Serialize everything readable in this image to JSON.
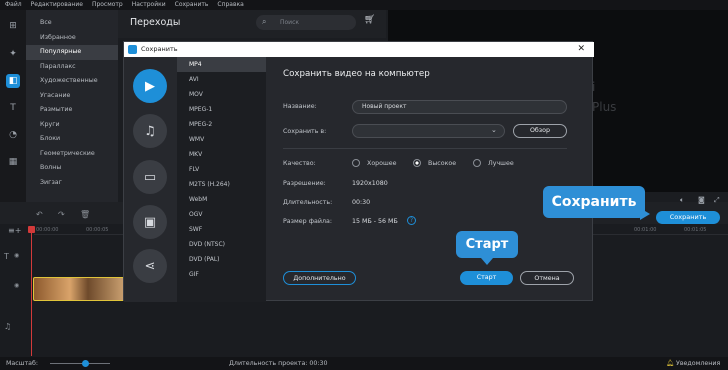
{
  "menu": [
    "Файл",
    "Редактирование",
    "Просмотр",
    "Настройки",
    "Сохранить",
    "Справка"
  ],
  "sidebar": {
    "items": [
      "Все",
      "Избранное",
      "Популярные",
      "Параллакс",
      "Художественные",
      "Угасание",
      "Размытие",
      "Круги",
      "Блоки",
      "Геометрические",
      "Волны",
      "Зигзаг"
    ],
    "active_index": 2
  },
  "transitions": {
    "title": "Переходы",
    "search_placeholder": "Поиск"
  },
  "preview": {
    "ghost_text_1": "i",
    "ghost_text_2": "Plus"
  },
  "main": {
    "save_button": "Сохранить",
    "callout_save": "Сохранить",
    "callout_start": "Старт"
  },
  "timeline": {
    "ruler_ticks": [
      "00:00:00",
      "00:00:05"
    ],
    "ruler_ticks_right": [
      "00:01:00",
      "00:01:05"
    ]
  },
  "status": {
    "scale_label": "Масштаб:",
    "duration_label": "Длительность проекта: 00:30",
    "notifications": "Уведомления"
  },
  "dialog": {
    "title": "Сохранить",
    "heading": "Сохранить видео на компьютер",
    "formats": [
      "MP4",
      "AVI",
      "MOV",
      "MPEG-1",
      "MPEG-2",
      "WMV",
      "MKV",
      "FLV",
      "M2TS (H.264)",
      "WebM",
      "OGV",
      "SWF",
      "DVD (NTSC)",
      "DVD (PAL)",
      "GIF"
    ],
    "active_format_index": 0,
    "name_label": "Название:",
    "name_value": "Новый проект",
    "saveto_label": "Сохранить в:",
    "saveto_value": "",
    "browse_button": "Обзор",
    "quality_label": "Качество:",
    "quality_options": [
      "Хорошее",
      "Высокое",
      "Лучшее"
    ],
    "quality_selected_index": 1,
    "resolution_label": "Разрешение:",
    "resolution_value": "1920x1080",
    "duration_label": "Длительность:",
    "duration_value": "00:30",
    "filesize_label": "Размер файла:",
    "filesize_value": "15 МБ - 56 МБ",
    "advanced_button": "Дополнительно",
    "start_button": "Старт",
    "cancel_button": "Отмена"
  },
  "colors": {
    "accent": "#1e8fd8",
    "clip_border": "#e0c43a",
    "playhead": "#d33a3a"
  }
}
